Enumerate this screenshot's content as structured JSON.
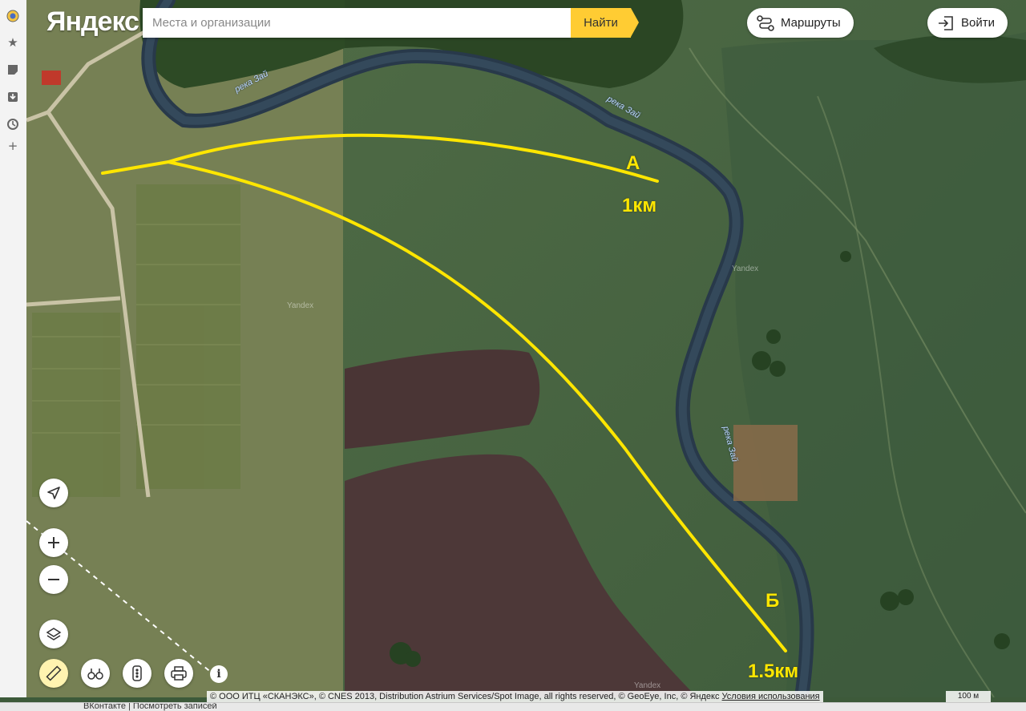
{
  "header": {
    "logo": "Яндекс",
    "search_placeholder": "Места и организации",
    "search_button": "Найти",
    "routes_label": "Маршруты",
    "login_label": "Войти"
  },
  "sidebar": {
    "items": [
      {
        "icon": "yandex-browser-icon"
      },
      {
        "icon": "star-icon"
      },
      {
        "icon": "note-icon"
      },
      {
        "icon": "download-icon"
      },
      {
        "icon": "clock-icon"
      },
      {
        "icon": "plus-icon"
      }
    ]
  },
  "map": {
    "river_labels": [
      "река Зай",
      "река Зай",
      "река Зай"
    ],
    "watermarks": [
      "Yandex",
      "Yandex",
      "Yandex"
    ],
    "annotations": {
      "point_a": "А",
      "distance_a": "1км",
      "point_b": "Б",
      "distance_b": "1.5км"
    },
    "line_color": "#ffe600"
  },
  "controls": {
    "locate_icon": "navigation-arrow-icon",
    "zoom_in_icon": "plus-icon",
    "zoom_out_icon": "minus-icon",
    "layers_icon": "layers-icon",
    "ruler_icon": "ruler-icon",
    "panorama_icon": "binoculars-icon",
    "traffic_icon": "traffic-light-icon",
    "print_icon": "printer-icon",
    "info_icon": "info-icon"
  },
  "footer": {
    "attribution": "© ООО ИТЦ «СКАНЭКС», © CNES 2013, Distribution Astrium Services/Spot Image, all rights reserved, © GeoEye, Inc, © Яндекс",
    "terms_link": "Условия использования",
    "scale_label": "100 м",
    "taskbar_text": "ВКонтакте | Посмотреть записей"
  }
}
